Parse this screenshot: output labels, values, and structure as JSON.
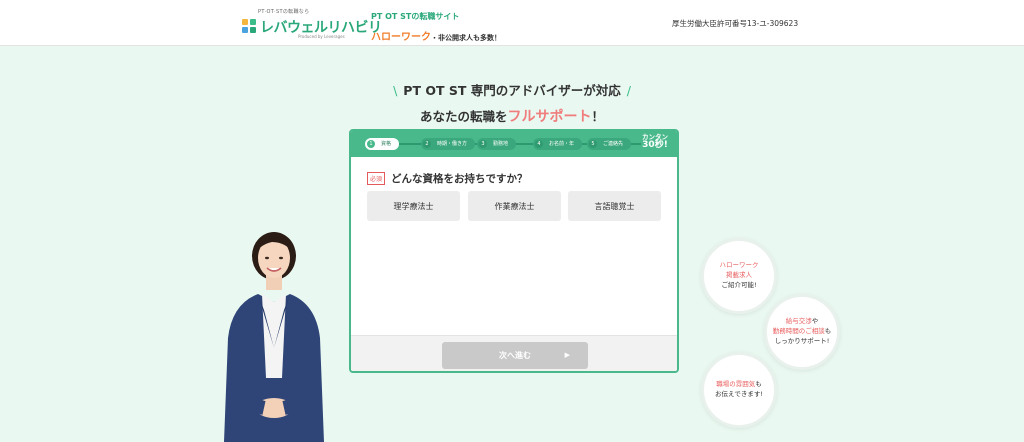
{
  "header": {
    "logo_tagline": "PT·OT·STの転職なら",
    "logo_text": "レバウェルリハビリ",
    "logo_sub": "Produced by Leverages",
    "promo_line1": "PT OT STの転職サイト",
    "promo_hello": "ハローワーク",
    "promo_rest": "・非公開求人も多数！",
    "license": "厚生労働大臣許可番号13-ユ-309623"
  },
  "headline": {
    "line1": "PT OT ST 専門のアドバイザーが対応",
    "line2_pre": "あなたの転職を",
    "line2_accent": "フルサポート",
    "line2_post": "！"
  },
  "steps": [
    {
      "num": "1",
      "label": "資格",
      "active": true
    },
    {
      "num": "2",
      "label": "時期・働き方",
      "active": false
    },
    {
      "num": "3",
      "label": "勤務地",
      "active": false
    },
    {
      "num": "4",
      "label": "お名前・年",
      "active": false
    },
    {
      "num": "5",
      "label": "ご連絡先",
      "active": false
    }
  ],
  "quick": {
    "line1": "カンタン",
    "line2": "30秒!"
  },
  "form": {
    "required_badge": "必須",
    "question": "どんな資格をお持ちですか？",
    "choices": [
      "理学療法士",
      "作業療法士",
      "言語聴覚士"
    ],
    "next_label": "次へ進む",
    "next_arrow": "▶"
  },
  "bubbles": {
    "b1": {
      "l1": "ハローワーク",
      "l2": "掲載求人",
      "l3": "ご紹介可能!"
    },
    "b2": {
      "l1a": "給与交渉",
      "l1b": "や",
      "l2a": "勤務時間のご相談",
      "l2b": "も",
      "l3": "しっかりサポート!"
    },
    "b3": {
      "l1a": "職場の雰囲気",
      "l1b": "も",
      "l2": "お伝えできます!"
    }
  },
  "colors": {
    "brand": "#49b98b",
    "accent": "#f07c7c",
    "orange": "#f07c2a",
    "background": "#e9f8f0"
  }
}
